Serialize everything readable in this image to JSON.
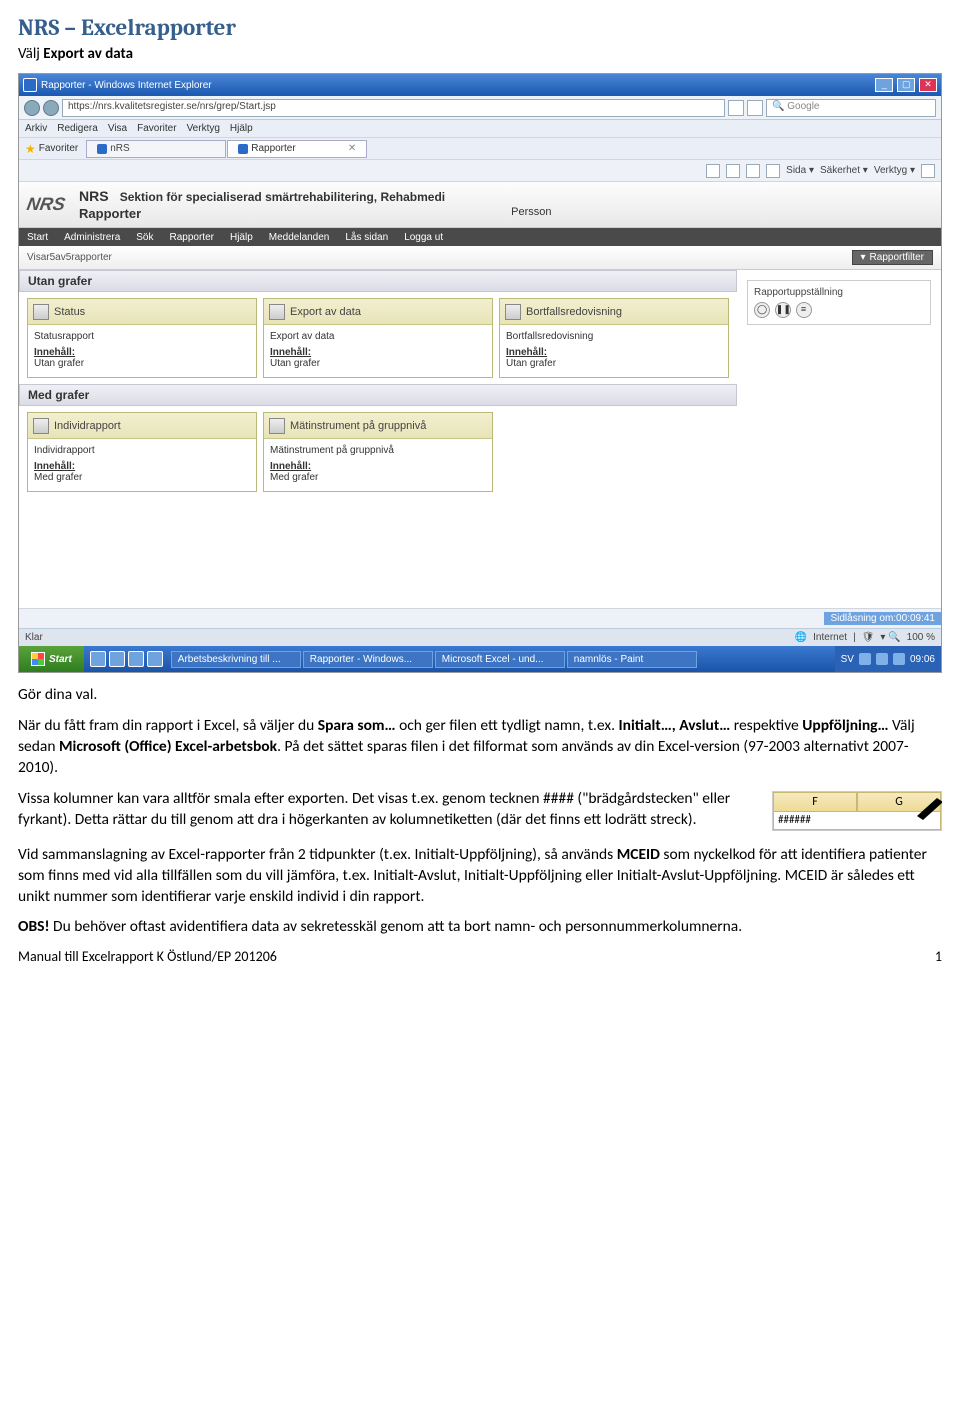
{
  "doc": {
    "title": "NRS – Excelrapporter",
    "intro_prefix": "Välj ",
    "intro_bold": "Export av data",
    "footer": "Manual till Excelrapport K Östlund/EP 201206",
    "page": "1"
  },
  "ie": {
    "title": "Rapporter - Windows Internet Explorer",
    "url": "https://nrs.kvalitetsregister.se/nrs/grep/Start.jsp",
    "search_ph": "Google",
    "menu": [
      "Arkiv",
      "Redigera",
      "Visa",
      "Favoriter",
      "Verktyg",
      "Hjälp"
    ],
    "fav": "Favoriter",
    "tab1": "nRS",
    "tab2": "Rapporter",
    "tb2_items": [
      "Sida",
      "Säkerhet",
      "Verktyg"
    ],
    "status_left": "Klar",
    "status_net": "Internet",
    "zoom": "100 %"
  },
  "nrs": {
    "logo": "NRS",
    "brand": "NRS",
    "section": "Sektion för specialiserad smärtrehabilitering, Rehabmedi",
    "sub": "Rapporter",
    "person": "Persson",
    "nav": [
      "Start",
      "Administrera",
      "Sök",
      "Rapporter",
      "Hjälp",
      "Meddelanden",
      "Lås sidan",
      "Logga ut"
    ],
    "filter_left": "Visar5av5rapporter",
    "filter_btn": "Rapportfilter",
    "sec1": "Utan grafer",
    "sec2": "Med grafer",
    "lock": "Sidlåsning om:00:09:41",
    "right_title": "Rapportuppställning",
    "cards1": [
      {
        "h": "Status",
        "t": "Statusrapport",
        "i": "Innehåll:",
        "c": "Utan grafer"
      },
      {
        "h": "Export av data",
        "t": "Export av data",
        "i": "Innehåll:",
        "c": "Utan grafer"
      },
      {
        "h": "Bortfallsredovisning",
        "t": "Bortfallsredovisning",
        "i": "Innehåll:",
        "c": "Utan grafer"
      }
    ],
    "cards2": [
      {
        "h": "Individrapport",
        "t": "Individrapport",
        "i": "Innehåll:",
        "c": "Med grafer"
      },
      {
        "h": "Mätinstrument på gruppnivå",
        "t": "Mätinstrument på gruppnivå",
        "i": "Innehåll:",
        "c": "Med grafer"
      }
    ]
  },
  "taskbar": {
    "start": "Start",
    "tasks": [
      "Arbetsbeskrivning till ...",
      "Rapporter - Windows...",
      "Microsoft Excel - und...",
      "namnlös - Paint"
    ],
    "lang": "SV",
    "time": "09:06"
  },
  "text": {
    "p1a": "Gör dina val.",
    "p1b_pre": "När du fått fram din rapport i Excel, så väljer du ",
    "p1b_b1": "Spara som…",
    "p1b_mid": " och ger filen ett tydligt namn, t.ex. ",
    "p1b_b2": "Initialt…, Avslut…",
    "p1b_mid2": " respektive ",
    "p1b_b3": "Uppföljning…",
    "p1b_mid3": " Välj sedan ",
    "p1b_b4": "Microsoft (Office) Excel-arbetsbok",
    "p1b_end": ". På det sättet sparas filen i det filformat som används av din Excel-version (97-2003 alternativt 2007-2010).",
    "p2": "Vissa kolumner kan vara alltför smala efter exporten. Det visas t.ex. genom tecknen #### (\"brädgårdstecken\" eller fyrkant). Detta rättar du till genom att dra i högerkanten av kolumnetiketten (där det finns ett lodrätt streck).",
    "p3_pre": "Vid sammanslagning av Excel-rapporter från 2 tidpunkter (t.ex. Initialt-Uppföljning), så används ",
    "p3_b1": "MCEID",
    "p3_end": " som nyckelkod för att identifiera patienter som finns med vid alla tillfällen som du vill jämföra, t.ex. Initialt-Avslut, Initialt-Uppföljning eller Initialt-Avslut-Uppföljning. MCEID är således ett unikt nummer som identifierar varje enskild individ i din rapport.",
    "p4_b": "OBS!",
    "p4": " Du behöver oftast avidentifiera data av sekretesskäl genom att ta bort namn- och personnummerkolumnerna.",
    "excel_f": "F",
    "excel_g": "G",
    "excel_hash": "######"
  }
}
